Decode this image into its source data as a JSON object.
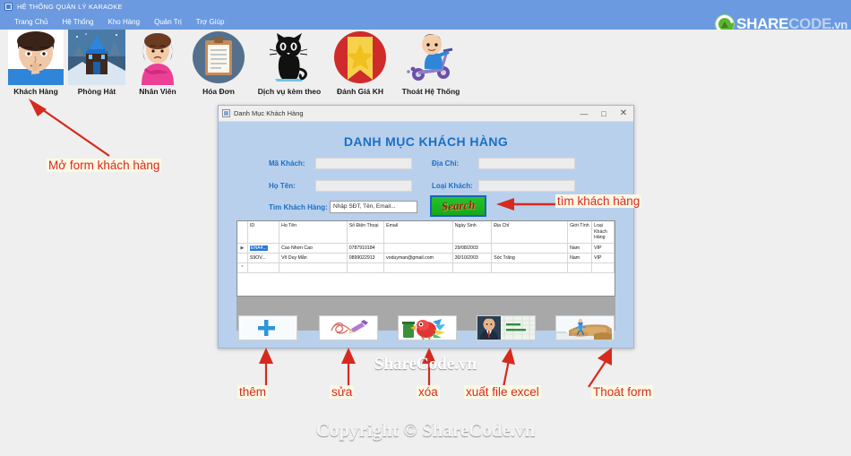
{
  "app": {
    "title": "HỆ THỐNG QUẢN LÝ KARAOKE",
    "icon": "app-window-icon"
  },
  "menubar": {
    "items": [
      {
        "label": "Trang Chủ"
      },
      {
        "label": "Hệ Thống"
      },
      {
        "label": "Kho Hàng"
      },
      {
        "label": "Quản Trị"
      },
      {
        "label": "Trợ Giúp"
      }
    ]
  },
  "brand": {
    "share": "SHARE",
    "code": "CODE",
    "vn": ".vn",
    "icon": "sharecode-recycle-icon"
  },
  "toolbar": {
    "buttons": [
      {
        "label": "Khách Hàng",
        "icon": "customer-face-icon"
      },
      {
        "label": "Phòng Hát",
        "icon": "karaoke-room-castle-icon"
      },
      {
        "label": "Nhân Viên",
        "icon": "employee-woman-icon"
      },
      {
        "label": "Hóa Đơn",
        "icon": "invoice-clipboard-icon"
      },
      {
        "label": "Dịch vụ kèm theo",
        "icon": "black-cat-service-icon"
      },
      {
        "label": "Đánh Giá KH",
        "icon": "star-rating-icon"
      },
      {
        "label": "Thoát Hệ Thống",
        "icon": "exit-boy-scooter-icon"
      }
    ]
  },
  "child_form": {
    "title": "Danh Mục Khách Hàng",
    "icon": "form-window-icon",
    "window_buttons": {
      "minimize": "—",
      "maximize": "□",
      "close": "✕"
    },
    "heading": "DANH MỤC KHÁCH HÀNG",
    "fields": {
      "ma_khach": {
        "label": "Mã Khách:",
        "value": ""
      },
      "ho_ten": {
        "label": "Họ Tên:",
        "value": ""
      },
      "dia_chi": {
        "label": "Địa Chỉ:",
        "value": ""
      },
      "loai_khach": {
        "label": "Loại Khách:",
        "value": ""
      },
      "tim_khach_hang": {
        "label": "Tìm Khách Hàng:",
        "value": "",
        "placeholder": "Nhập SĐT, Tên, Email..."
      }
    },
    "search_button": {
      "label": "Search"
    },
    "grid": {
      "columns": [
        "ID",
        "Họ Tên",
        "Số Điện Thoại",
        "Email",
        "Ngày Sinh",
        "Địa Chỉ",
        "Giới Tính",
        "Loại Khách Hàng"
      ],
      "rows": [
        {
          "marker": "▶",
          "selected": true,
          "cells": [
            "ENA4...",
            "Cao Nhơn Cao",
            "0787910184",
            "",
            "29/08/2003",
            "",
            "Nam",
            "VIP"
          ]
        },
        {
          "marker": "",
          "selected": false,
          "cells": [
            "S9OV...",
            "Võ Duy Mẫn",
            "0899022913",
            "voduyman@gmail.com",
            "30/10/2003",
            "Sóc Trăng",
            "Nam",
            "VIP"
          ]
        },
        {
          "marker": "*",
          "selected": false,
          "cells": [
            "",
            "",
            "",
            "",
            "",
            "",
            "",
            ""
          ]
        }
      ]
    },
    "action_buttons": [
      {
        "name": "add-button",
        "icon": "blue-plus-icon"
      },
      {
        "name": "edit-button",
        "icon": "pen-scribble-icon"
      },
      {
        "name": "delete-button",
        "icon": "parrot-trash-icon"
      },
      {
        "name": "export-excel-button",
        "icon": "man-spreadsheet-icon"
      },
      {
        "name": "exit-form-button",
        "icon": "person-on-cliff-icon"
      }
    ]
  },
  "annotations": [
    {
      "id": "anno-open-form",
      "text": "Mở form khách hàng"
    },
    {
      "id": "anno-search",
      "text": "tìm khách hàng"
    },
    {
      "id": "anno-add",
      "text": "thêm"
    },
    {
      "id": "anno-edit",
      "text": "sửa"
    },
    {
      "id": "anno-delete",
      "text": "xóa"
    },
    {
      "id": "anno-export",
      "text": "xuất file excel"
    },
    {
      "id": "anno-exit",
      "text": "Thoát form"
    }
  ],
  "watermarks": {
    "middle": "ShareCode.vn",
    "bottom": "Copyright © ShareCode.vn"
  },
  "colors": {
    "menubar": "#6b9ae0",
    "form_background": "#b9d0ec",
    "heading": "#1b6fc4",
    "annotation": "#d62a1e",
    "search_green": "#18a81a",
    "selection_blue": "#2a7ad4"
  }
}
